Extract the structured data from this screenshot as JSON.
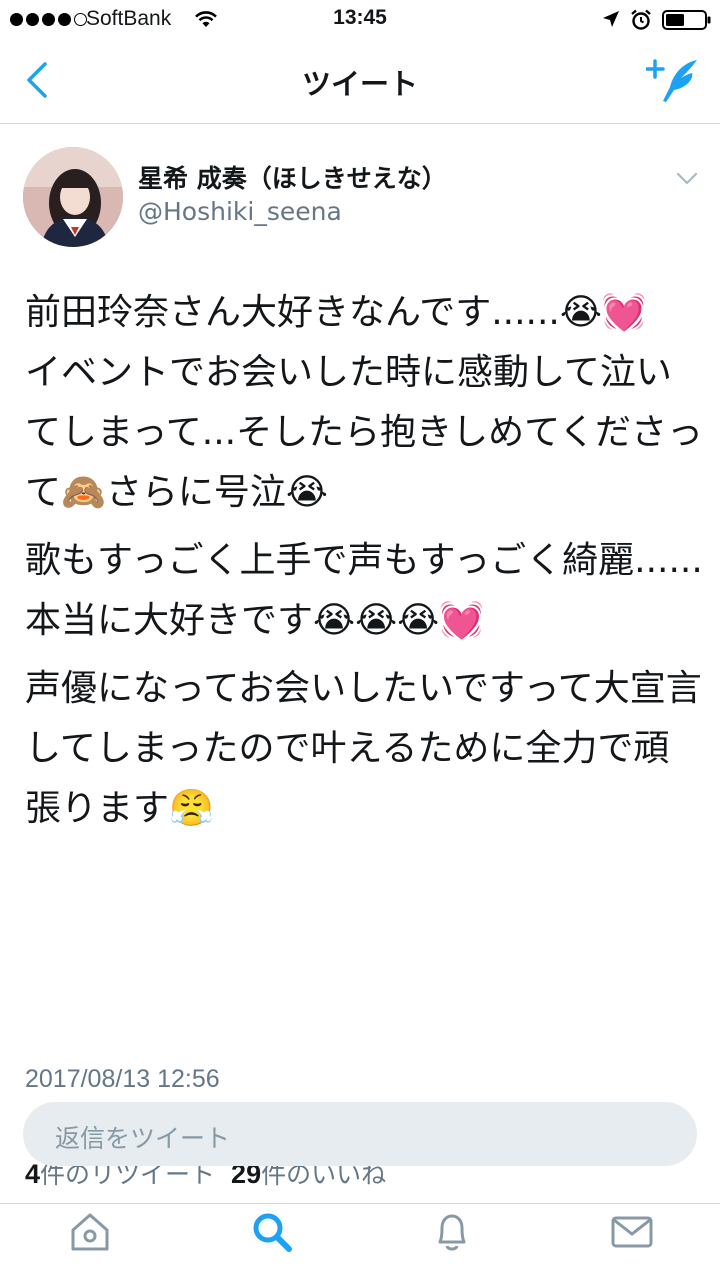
{
  "status_bar": {
    "carrier": "SoftBank",
    "time": "13:45"
  },
  "nav": {
    "title": "ツイート",
    "back_icon": "chevron-left-icon",
    "compose_icon": "compose-tweet-icon"
  },
  "tweet": {
    "user_name": "星希 成奏（ほしきせえな）",
    "handle": "@Hoshiki_seena",
    "paragraphs": [
      "前田玲奈さん大好きなんです......😭💓\nイベントでお会いした時に感動して泣いてしまって...そしたら抱きしめてくださって🙈さらに号泣😭",
      "歌もすっごく上手で声もすっごく綺麗......本当に大好きです😭😭😭💓",
      "声優になってお会いしたいですって大宣言してしまったので叶えるために全力で頑張ります😤"
    ],
    "timestamp": "2017/08/13 12:56",
    "retweet_count": "4",
    "retweet_label": "件のリツイート",
    "like_count": "29",
    "like_label": "件のいいね"
  },
  "reply": {
    "placeholder": "返信をツイート"
  },
  "tabs": [
    {
      "icon": "home-icon"
    },
    {
      "icon": "search-icon"
    },
    {
      "icon": "notifications-icon"
    },
    {
      "icon": "messages-icon"
    }
  ],
  "colors": {
    "accent": "#1da1f2",
    "secondary_text": "#657786",
    "divider": "#d6d9dc"
  }
}
